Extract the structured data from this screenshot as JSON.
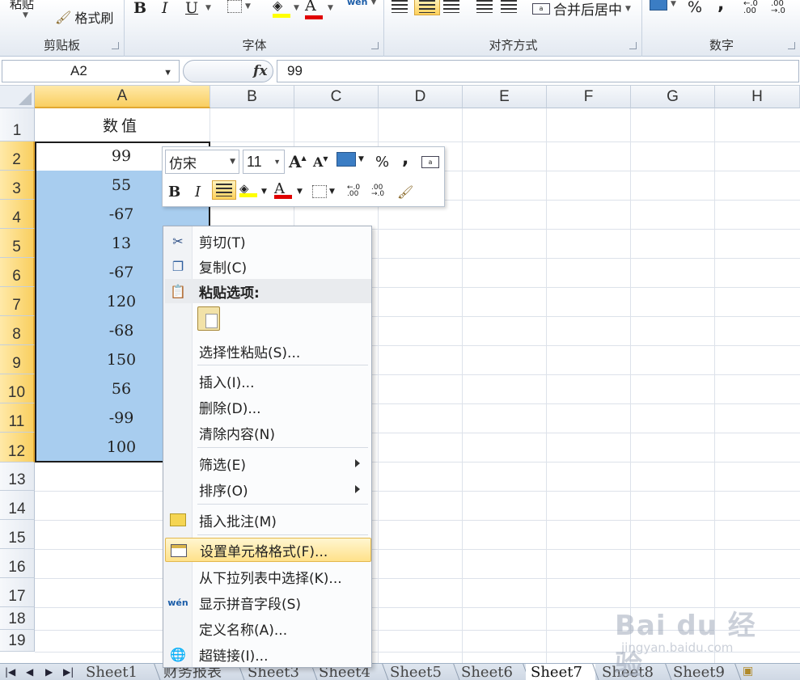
{
  "ribbon": {
    "clipboard": {
      "paste_label": "粘贴",
      "format_painter_label": "格式刷",
      "group_label": "剪贴板"
    },
    "font": {
      "bold": "B",
      "italic": "I",
      "underline": "U",
      "font_color_glyph": "A",
      "phonetic_glyph": "wén",
      "group_label": "字体"
    },
    "alignment": {
      "merge_center_label": "合并后居中",
      "group_label": "对齐方式"
    },
    "number": {
      "percent": "%",
      "comma": ",",
      "group_label": "数字",
      "inc_decimal": "←.0 .00",
      "dec_decimal": ".00 →.0"
    },
    "colors": {
      "fill_yellow": "#ffff00",
      "font_red": "#e00000"
    }
  },
  "formula_bar": {
    "name_box": "A2",
    "fx_label": "fx",
    "value": "99"
  },
  "grid": {
    "columns": [
      "A",
      "B",
      "C",
      "D",
      "E",
      "F",
      "G",
      "H"
    ],
    "rows": [
      "1",
      "2",
      "3",
      "4",
      "5",
      "6",
      "7",
      "8",
      "9",
      "10",
      "11",
      "12",
      "13",
      "14",
      "15",
      "16",
      "17",
      "18",
      "19"
    ],
    "selected_column": "A",
    "header_cell": "数值",
    "values": [
      "99",
      "55",
      "-67",
      "13",
      "-67",
      "120",
      "-68",
      "150",
      "56",
      "-99",
      "100"
    ],
    "selection_color": "#a8cdef"
  },
  "mini_toolbar": {
    "font_name": "仿宋",
    "font_size": "11",
    "grow_font": "A",
    "shrink_font": "A",
    "percent": "%",
    "comma": ",",
    "bold": "B",
    "italic": "I",
    "font_color_glyph": "A"
  },
  "context_menu": {
    "cut": "剪切(T)",
    "copy": "复制(C)",
    "paste_options": "粘贴选项:",
    "paste_special": "选择性粘贴(S)...",
    "insert": "插入(I)...",
    "delete": "删除(D)...",
    "clear_contents": "清除内容(N)",
    "filter": "筛选(E)",
    "sort": "排序(O)",
    "insert_comment": "插入批注(M)",
    "format_cells": "设置单元格格式(F)...",
    "pick_from_list": "从下拉列表中选择(K)...",
    "show_phonetic": "显示拼音字段(S)",
    "define_name": "定义名称(A)...",
    "hyperlink": "超链接(I)..."
  },
  "sheet_tabs": {
    "tabs": [
      "Sheet1",
      "财务报表",
      "Sheet3",
      "Sheet4",
      "Sheet5",
      "Sheet6",
      "Sheet7",
      "Sheet8",
      "Sheet9"
    ],
    "active": "Sheet7"
  },
  "watermark": {
    "brand": "Bai du 经验",
    "url": "jingyan.baidu.com"
  }
}
